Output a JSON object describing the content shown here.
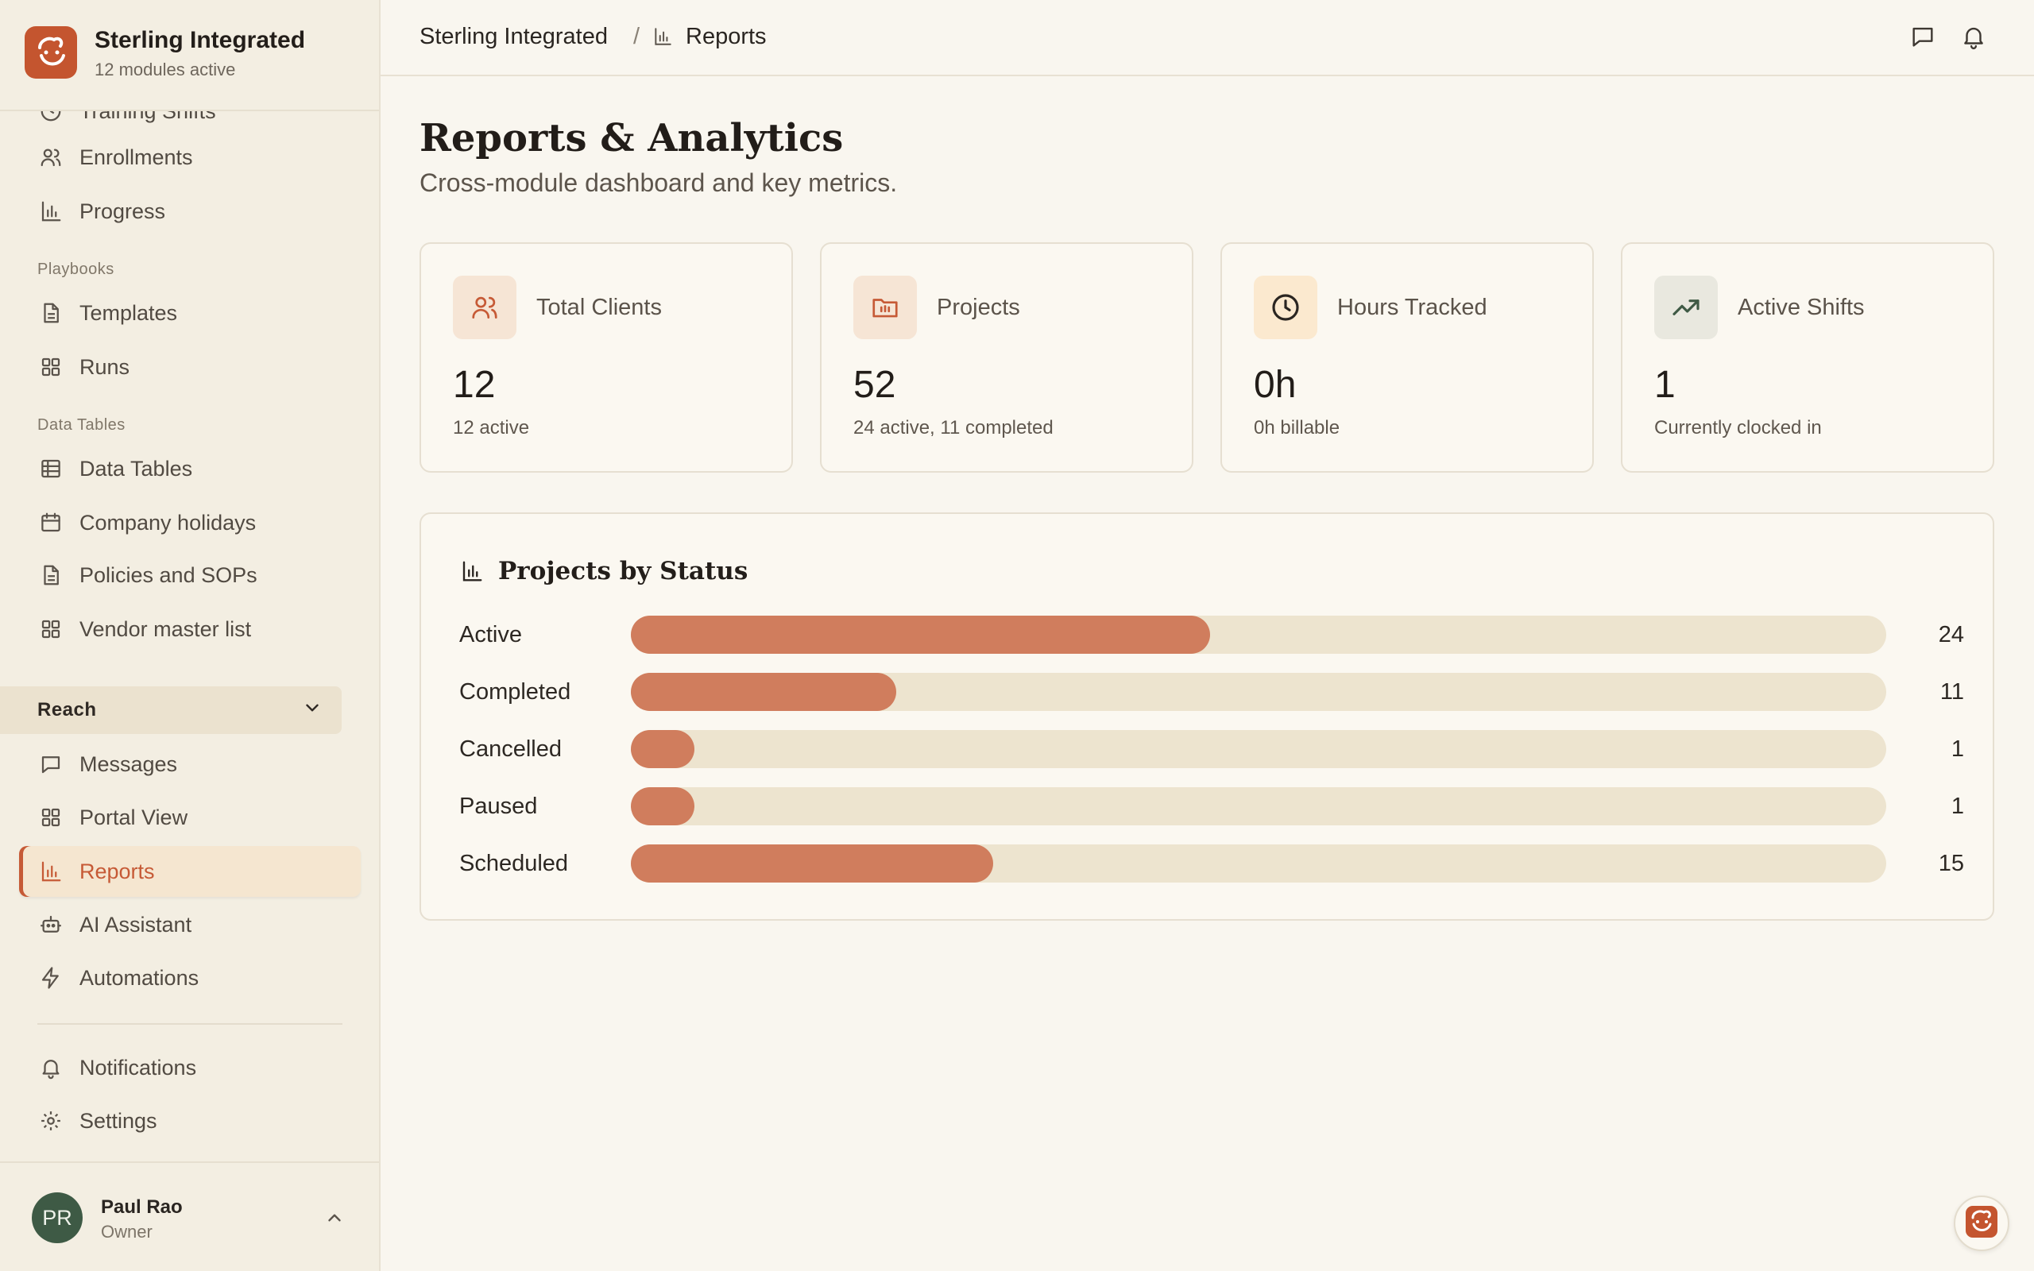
{
  "brand": {
    "title": "Sterling Integrated",
    "subtitle": "12 modules active"
  },
  "sidebar": {
    "partial_item": "Training Shifts",
    "items": [
      {
        "label": "Enrollments",
        "icon": "users-icon"
      },
      {
        "label": "Progress",
        "icon": "bar-chart-icon"
      },
      {
        "label": "Templates",
        "icon": "document-icon"
      },
      {
        "label": "Runs",
        "icon": "grid-icon"
      },
      {
        "label": "Data Tables",
        "icon": "table-icon"
      },
      {
        "label": "Company holidays",
        "icon": "calendar-icon"
      },
      {
        "label": "Policies and SOPs",
        "icon": "document-icon"
      },
      {
        "label": "Vendor master list",
        "icon": "grid-icon"
      },
      {
        "label": "Messages",
        "icon": "message-icon"
      },
      {
        "label": "Portal View",
        "icon": "grid-icon"
      },
      {
        "label": "Reports",
        "icon": "bar-chart-icon",
        "active": true
      },
      {
        "label": "AI Assistant",
        "icon": "bot-icon"
      },
      {
        "label": "Automations",
        "icon": "lightning-icon"
      },
      {
        "label": "Notifications",
        "icon": "bell-icon"
      },
      {
        "label": "Settings",
        "icon": "gear-icon"
      }
    ],
    "sections": {
      "playbooks": "Playbooks",
      "data_tables": "Data Tables"
    },
    "group": {
      "label": "Reach",
      "expanded": true
    }
  },
  "user": {
    "initials": "PR",
    "name": "Paul Rao",
    "role": "Owner"
  },
  "breadcrumb": {
    "root": "Sterling Integrated",
    "separator": "/",
    "current": "Reports"
  },
  "page": {
    "title": "Reports & Analytics",
    "subtitle": "Cross-module dashboard and key metrics."
  },
  "stats": [
    {
      "label": "Total Clients",
      "value": "12",
      "note": "12 active",
      "icon": "users-icon",
      "icon_bg": "#f6e5d5",
      "icon_color": "#c65a36"
    },
    {
      "label": "Projects",
      "value": "52",
      "note": "24 active, 11 completed",
      "icon": "folder-icon",
      "icon_bg": "#f6e5d5",
      "icon_color": "#c65a36"
    },
    {
      "label": "Hours Tracked",
      "value": "0h",
      "note": "0h billable",
      "icon": "clock-icon",
      "icon_bg": "#fbe9cf",
      "icon_color": "#2a2521"
    },
    {
      "label": "Active Shifts",
      "value": "1",
      "note": "Currently clocked in",
      "icon": "trending-up-icon",
      "icon_bg": "#e9e8df",
      "icon_color": "#3f5a45"
    }
  ],
  "status_panel": {
    "title": "Projects by Status"
  },
  "chart_data": {
    "type": "bar",
    "orientation": "horizontal",
    "title": "Projects by Status",
    "categories": [
      "Active",
      "Completed",
      "Cancelled",
      "Paused",
      "Scheduled"
    ],
    "values": [
      24,
      11,
      1,
      1,
      15
    ],
    "xlim": [
      0,
      52
    ],
    "grid": false,
    "bar_color": "#d07d5d",
    "track_color": "#ede4cf"
  },
  "colors": {
    "accent": "#c65a36",
    "background": "#f9f6ef",
    "sidebar": "#f3eee2",
    "avatar": "#3e5a45"
  }
}
